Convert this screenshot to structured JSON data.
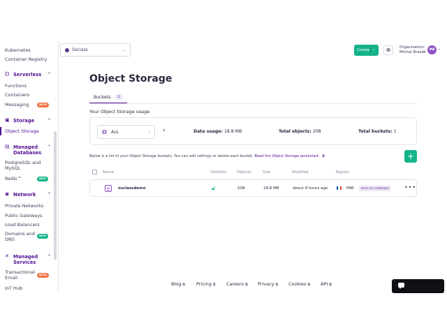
{
  "sidebar": {
    "items": {
      "kubernetes": "Kubernetes",
      "container_registry": "Container Registry",
      "functions": "Functions",
      "containers": "Containers",
      "messaging": "Messaging",
      "object_storage": "Object Storage",
      "postgresql": "PostgreSQL and MySQL",
      "redis": "Redis™",
      "private_networks": "Private Networks",
      "public_gateways": "Public Gateways",
      "load_balancers": "Load Balancers",
      "domains_dns": "Domains and DNS",
      "transactional_email": "Transactional Email",
      "iot_hub": "IoT Hub"
    },
    "sections": {
      "serverless": "Serverless",
      "storage": "Storage",
      "managed_databases": "Managed Databases",
      "network": "Network",
      "managed_services": "Managed Services"
    },
    "badges": {
      "beta": "BETA",
      "new": "NEW"
    }
  },
  "topbar": {
    "project": "Osclass",
    "create_label": "Create",
    "organization_label": "Organization:",
    "user_name": "Michal Brezák",
    "avatar_initials": "MB"
  },
  "main": {
    "title": "Object Storage",
    "tab": {
      "label": "Buckets",
      "count": "1"
    },
    "usage_title": "Your Object Storage usage",
    "region": "ALL",
    "stats": {
      "data_usage_label": "Data usage:",
      "data_usage_value": "18.8 MB",
      "total_objects_label": "Total objects:",
      "total_objects_value": "208",
      "total_buckets_label": "Total buckets:",
      "total_buckets_value": "1"
    },
    "info_text": "Below is a list of your Object Storage buckets. You can edit settings or delete each bucket.",
    "info_link": "Read the Object Storage quickstart.",
    "add_label": "+",
    "table": {
      "headers": {
        "name": "Name",
        "visibility": "Visibility",
        "objects": "Objects",
        "size": "Size",
        "modified": "Modified",
        "region": "Region"
      },
      "rows": [
        {
          "name": "osclassdemo",
          "objects": "208",
          "size": "18.8 MB",
          "modified": "about 4 hours ago",
          "region": "PAR",
          "badge": "MULTI AZ COMPATIBLE",
          "more": "•••"
        }
      ]
    }
  },
  "footer": {
    "links": {
      "blog": "Blog",
      "pricing": "Pricing",
      "careers": "Careers",
      "privacy": "Privacy",
      "cookies": "Cookies",
      "api": "API"
    }
  },
  "colors": {
    "brand_purple": "#521094",
    "accent_green": "#14b38a",
    "beta_orange": "#f07448"
  },
  "icons": {
    "globe": "globe-icon",
    "visibility": "unlock-icon",
    "bucket": "bucket-icon",
    "external": "external-link-icon",
    "chat": "chat-icon"
  }
}
